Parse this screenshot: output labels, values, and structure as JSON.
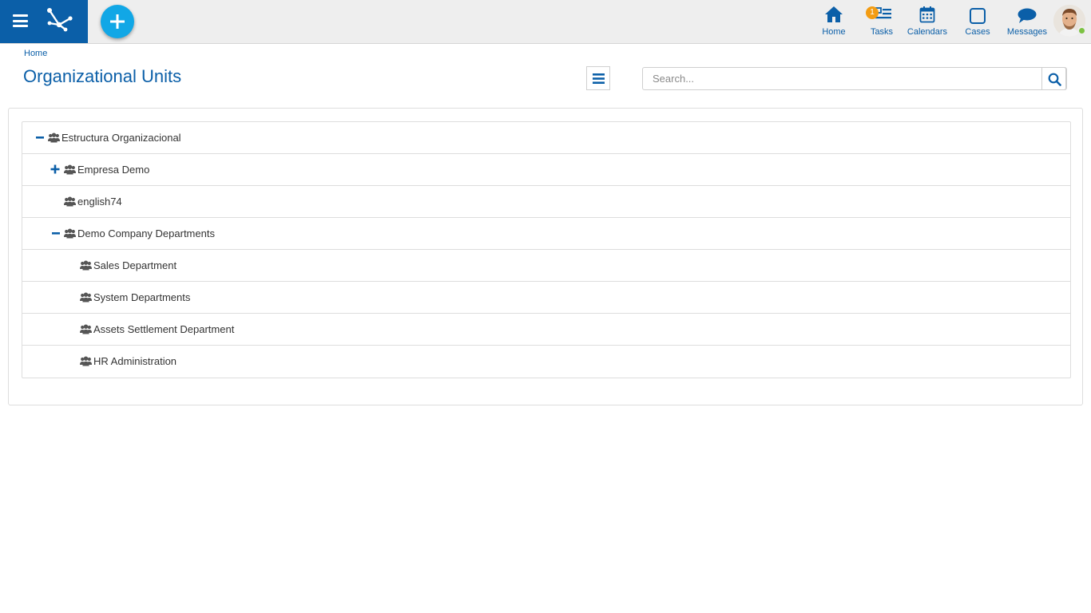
{
  "topbar": {
    "nav": [
      {
        "label": "Home",
        "icon": "home-icon"
      },
      {
        "label": "Tasks",
        "icon": "tasks-icon",
        "badge": "1"
      },
      {
        "label": "Calendars",
        "icon": "calendar-icon"
      },
      {
        "label": "Cases",
        "icon": "cases-icon"
      },
      {
        "label": "Messages",
        "icon": "messages-icon"
      }
    ],
    "colors": {
      "brand": "#0b5fa8",
      "fab": "#11a7e6",
      "badge": "#f39c12",
      "online": "#7cc242"
    }
  },
  "breadcrumb": "Home",
  "page_title": "Organizational Units",
  "search": {
    "placeholder": "Search...",
    "value": ""
  },
  "tree": [
    {
      "label": "Estructura Organizacional",
      "level": 0,
      "toggle": "collapse"
    },
    {
      "label": "Empresa Demo",
      "level": 1,
      "toggle": "expand"
    },
    {
      "label": "english74",
      "level": 1,
      "toggle": "none"
    },
    {
      "label": "Demo Company Departments",
      "level": 1,
      "toggle": "collapse"
    },
    {
      "label": "Sales Department",
      "level": 2,
      "toggle": "none"
    },
    {
      "label": "System Departments",
      "level": 2,
      "toggle": "none"
    },
    {
      "label": "Assets Settlement Department",
      "level": 2,
      "toggle": "none"
    },
    {
      "label": "HR Administration",
      "level": 2,
      "toggle": "none"
    }
  ]
}
